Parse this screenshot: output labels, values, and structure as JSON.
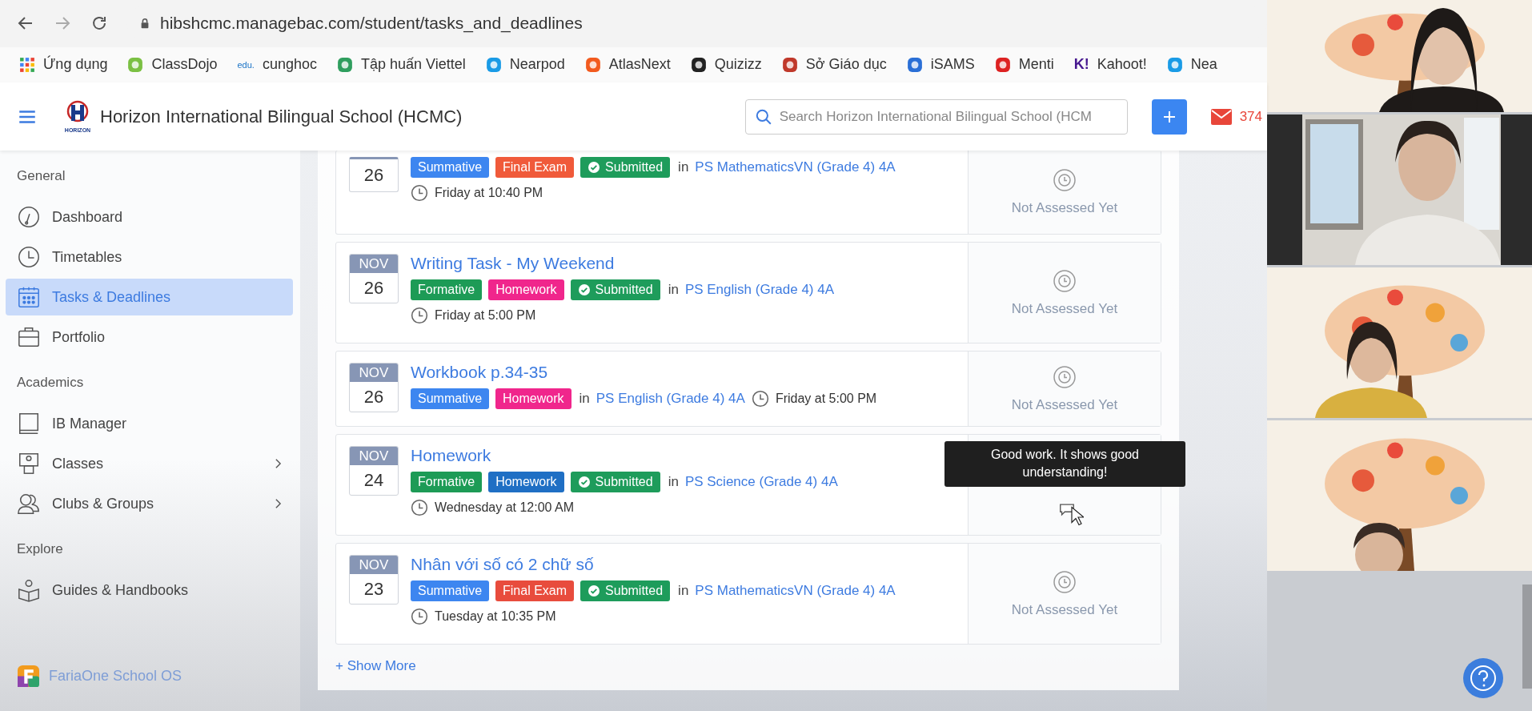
{
  "browser": {
    "url": "hibshcmc.managebac.com/student/tasks_and_deadlines",
    "bookmarks": [
      {
        "label": "Ứng dụng"
      },
      {
        "label": "ClassDojo"
      },
      {
        "label": "cunghoc",
        "logo_text": "edu."
      },
      {
        "label": "Tập huấn Viettel"
      },
      {
        "label": "Nearpod"
      },
      {
        "label": "AtlasNext"
      },
      {
        "label": "Quizizz"
      },
      {
        "label": "Sở Giáo dục"
      },
      {
        "label": "iSAMS"
      },
      {
        "label": "Menti"
      },
      {
        "label": "Kahoot!",
        "logo_text": "K!"
      },
      {
        "label": "Nea"
      }
    ]
  },
  "header": {
    "logo_text": "HORIZON",
    "school": "Horizon International Bilingual School (HCMC)",
    "search": {
      "placeholder": "Search Horizon International Bilingual School (HCM"
    },
    "mail_count": "374"
  },
  "sidebar": {
    "sections": [
      {
        "title": "General",
        "items": [
          {
            "label": "Dashboard",
            "selected": false,
            "expandable": false
          },
          {
            "label": "Timetables",
            "selected": false,
            "expandable": false
          },
          {
            "label": "Tasks & Deadlines",
            "selected": true,
            "expandable": false
          },
          {
            "label": "Portfolio",
            "selected": false,
            "expandable": false
          }
        ]
      },
      {
        "title": "Academics",
        "items": [
          {
            "label": "IB Manager",
            "selected": false,
            "expandable": false
          },
          {
            "label": "Classes",
            "selected": false,
            "expandable": true
          },
          {
            "label": "Clubs & Groups",
            "selected": false,
            "expandable": true
          }
        ]
      },
      {
        "title": "Explore",
        "items": [
          {
            "label": "Guides & Handbooks",
            "selected": false,
            "expandable": false
          }
        ]
      }
    ],
    "footer": "FariaOne School OS"
  },
  "tasks": [
    {
      "kind": "stacked",
      "day": "26",
      "tags": [
        {
          "label": "Summative",
          "color": "#3d86f0",
          "kind": "category"
        },
        {
          "label": "Final Exam",
          "color": "#f05a3a",
          "kind": "category"
        },
        {
          "label": "Submitted",
          "color": "#1e9c5b",
          "kind": "status"
        }
      ],
      "class_prefix": "in",
      "class": "PS MathematicsVN (Grade 4) 4A",
      "due": "Friday at 10:40 PM",
      "assessment": {
        "kind": "pending",
        "label": "Not Assessed Yet"
      }
    },
    {
      "kind": "stacked",
      "month": "NOV",
      "day": "26",
      "title": "Writing Task - My Weekend",
      "tags": [
        {
          "label": "Formative",
          "color": "#1d9b56",
          "kind": "category"
        },
        {
          "label": "Homework",
          "color": "#f0268c",
          "kind": "category"
        },
        {
          "label": "Submitted",
          "color": "#1e9c5b",
          "kind": "status"
        }
      ],
      "class_prefix": "in",
      "class": "PS English (Grade 4) 4A",
      "due": "Friday at 5:00 PM",
      "assessment": {
        "kind": "pending",
        "label": "Not Assessed Yet"
      }
    },
    {
      "kind": "inline",
      "month": "NOV",
      "day": "26",
      "title": "Workbook p.34-35",
      "tags": [
        {
          "label": "Summative",
          "color": "#3d86f0",
          "kind": "category"
        },
        {
          "label": "Homework",
          "color": "#f0268c",
          "kind": "category"
        }
      ],
      "class_prefix": "in",
      "class": "PS English (Grade 4) 4A",
      "due": "Friday at 5:00 PM",
      "assessment": {
        "kind": "pending",
        "label": "Not Assessed Yet"
      }
    },
    {
      "kind": "stacked",
      "month": "NOV",
      "day": "24",
      "title": "Homework",
      "tags": [
        {
          "label": "Formative",
          "color": "#1d9b56",
          "kind": "category"
        },
        {
          "label": "Homework",
          "color": "#1f6fc4",
          "kind": "category"
        },
        {
          "label": "Submitted",
          "color": "#1e9c5b",
          "kind": "status"
        }
      ],
      "class_prefix": "in",
      "class": "PS Science (Grade 4) 4A",
      "due": "Wednesday at 12:00 AM",
      "assessment": {
        "kind": "comment",
        "tooltip": "Good work. It shows good understanding!"
      }
    },
    {
      "kind": "stacked",
      "month": "NOV",
      "day": "23",
      "title": "Nhân với số có 2 chữ số",
      "tags": [
        {
          "label": "Summative",
          "color": "#3d86f0",
          "kind": "category"
        },
        {
          "label": "Final Exam",
          "color": "#e84c3d",
          "kind": "category"
        },
        {
          "label": "Submitted",
          "color": "#1e9c5b",
          "kind": "status"
        }
      ],
      "class_prefix": "in",
      "class": "PS MathematicsVN (Grade 4) 4A",
      "due": "Tuesday at 10:35 PM",
      "assessment": {
        "kind": "pending",
        "label": "Not Assessed Yet"
      }
    }
  ],
  "show_more": "+ Show More"
}
